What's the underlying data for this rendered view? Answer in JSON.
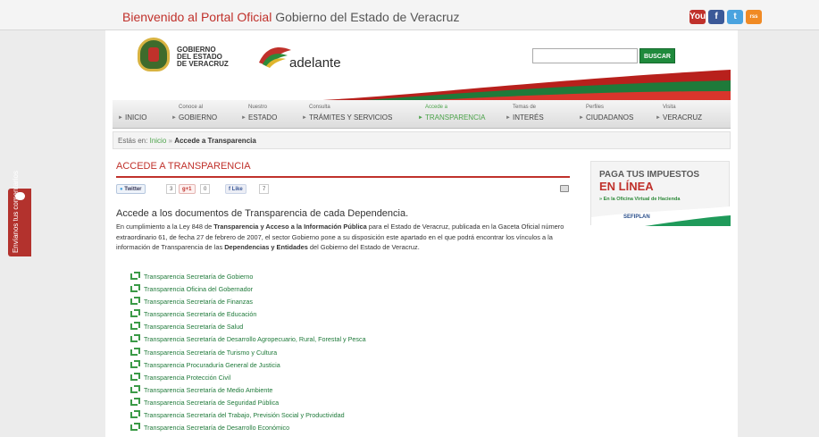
{
  "topbar": {
    "welcome_red": "Bienvenido al Portal Oficial",
    "welcome_rest": " Gobierno del Estado de Veracruz",
    "social": [
      {
        "name": "youtube-icon",
        "label": "You",
        "color": "#c0312b"
      },
      {
        "name": "facebook-icon",
        "label": "f",
        "color": "#3b5998"
      },
      {
        "name": "twitter-icon",
        "label": "t",
        "color": "#4aa3df"
      },
      {
        "name": "rss-icon",
        "label": "rss",
        "color": "#f08a24"
      }
    ]
  },
  "side_tab": {
    "label": "Envíanos tus comentarios"
  },
  "header": {
    "gov_line1": "GOBIERNO",
    "gov_line2": "DEL ESTADO",
    "gov_line3": "DE VERACRUZ",
    "adelante": "adelante",
    "search_value": "",
    "search_button": "BUSCAR"
  },
  "nav": [
    {
      "small": "",
      "big": "INICIO",
      "active": false
    },
    {
      "small": "Conoce al",
      "big": "GOBIERNO",
      "active": false
    },
    {
      "small": "Nuestro",
      "big": "ESTADO",
      "active": false
    },
    {
      "small": "Consulta",
      "big": "TRÁMITES Y SERVICIOS",
      "active": false
    },
    {
      "small": "Accede a",
      "big": "TRANSPARENCIA",
      "active": true
    },
    {
      "small": "Temas de",
      "big": "INTERÉS",
      "active": false
    },
    {
      "small": "Perfiles",
      "big": "CIUDADANOS",
      "active": false
    },
    {
      "small": "Visita",
      "big": "VERACRUZ",
      "active": false
    }
  ],
  "breadcrumb": {
    "label": "Estás en:",
    "home": "Inicio",
    "sep": "»",
    "current": "Accede a Transparencia"
  },
  "section_title": "ACCEDE A TRANSPARENCIA",
  "share": {
    "twitter": "Twitter",
    "twitter_count": "3",
    "gplus": "+1",
    "gplus_count": "0",
    "like": "Like",
    "like_count": "7"
  },
  "intro": {
    "title": "Accede a los documentos de Transparencia de cada Dependencia.",
    "p1": "En cumplimiento a la Ley 848 de ",
    "b1": "Transparencia y Acceso a la Información Pública",
    "p2": " para el Estado de Veracruz, publicada en la Gaceta Oficial número extraordinario 61, de fecha 27 de febrero de 2007, el sector Gobierno pone a su disposición este apartado en el que podrá encontrar los vínculos a la información de Transparencia de las ",
    "b2": "Dependencias y Entidades",
    "p3": " del Gobierno del Estado de Veracruz."
  },
  "links": [
    "Transparencia Secretaría de Gobierno",
    "Transparencia Oficina del Gobernador",
    "Transparencia Secretaría de Finanzas",
    "Transparencia Secretaría de Educación",
    "Transparencia Secretaría de Salud",
    "Transparencia Secretaría de Desarrollo Agropecuario, Rural, Forestal y Pesca",
    "Transparencia Secretaría de Turismo y Cultura",
    "Transparencia Procuraduría General de Justicia",
    "Transparencia Protección Civil",
    "Transparencia Secretaría de Medio Ambiente",
    "Transparencia Secretaría de Seguridad Pública",
    "Transparencia Secretaría del Trabajo, Previsión Social y Productividad",
    "Transparencia Secretaría de Desarrollo Económico"
  ],
  "ad": {
    "title1": "PAGA TUS IMPUESTOS",
    "title2": "EN LÍNEA",
    "sub": "» En la Oficina Virtual de Hacienda",
    "logo": "SEFIPLAN"
  }
}
